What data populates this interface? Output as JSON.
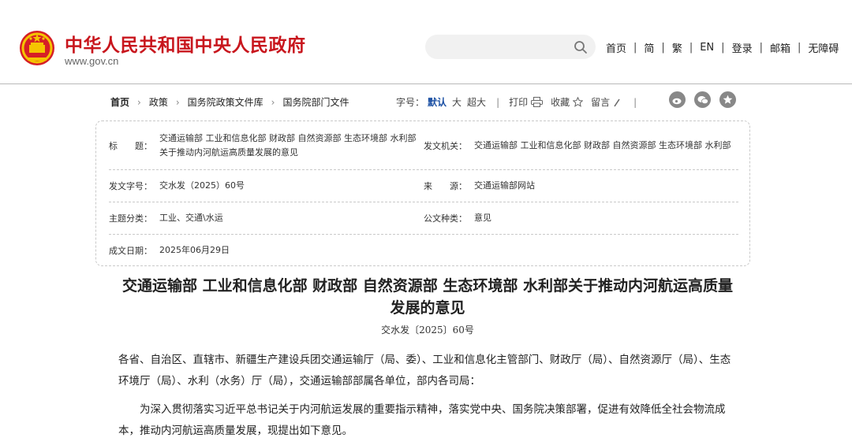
{
  "header": {
    "site_title": "中华人民共和国中央人民政府",
    "site_url": "www.gov.cn",
    "nav": [
      "首页",
      "简",
      "繁",
      "EN",
      "登录",
      "邮箱",
      "无障碍"
    ]
  },
  "breadcrumb": {
    "items": [
      "首页",
      "政策",
      "国务院政策文件库",
      "国务院部门文件"
    ]
  },
  "tools": {
    "font_size_label": "字号：",
    "font_sizes": [
      "默认",
      "大",
      "超大"
    ],
    "print": "打印",
    "favorite": "收藏",
    "comment": "留言"
  },
  "info": {
    "title_key": "标　　题：",
    "title_value": "交通运输部 工业和信息化部 财政部 自然资源部 生态环境部 水利部关于推动内河航运高质量发展的意见",
    "issuer_key": "发文机关：",
    "issuer_value": "交通运输部 工业和信息化部 财政部 自然资源部 生态环境部 水利部",
    "doc_no_key": "发文字号：",
    "doc_no_value": "交水发（2025）60号",
    "source_key": "来　　源：",
    "source_value": "交通运输部网站",
    "topic_key": "主题分类：",
    "topic_value": "工业、交通\\水运",
    "type_key": "公文种类：",
    "type_value": "意见",
    "date_key": "成文日期：",
    "date_value": "2025年06月29日"
  },
  "article": {
    "title": "交通运输部 工业和信息化部 财政部 自然资源部 生态环境部 水利部关于推动内河航运高质量发展的意见",
    "doc_no": "交水发〔2025〕60号",
    "recipients": "各省、自治区、直辖市、新疆生产建设兵团交通运输厅（局、委）、工业和信息化主管部门、财政厅（局）、自然资源厅（局）、生态环境厅（局）、水利（水务）厅（局），交通运输部部属各单位，部内各司局：",
    "intro": "为深入贯彻落实习近平总书记关于内河航运发展的重要指示精神，落实党中央、国务院决策部署，促进有效降低全社会物流成本，推动内河航运高质量发展，现提出如下意见。"
  },
  "colors": {
    "brand_red": "#c8161d",
    "link_blue": "#1a4fa3"
  }
}
